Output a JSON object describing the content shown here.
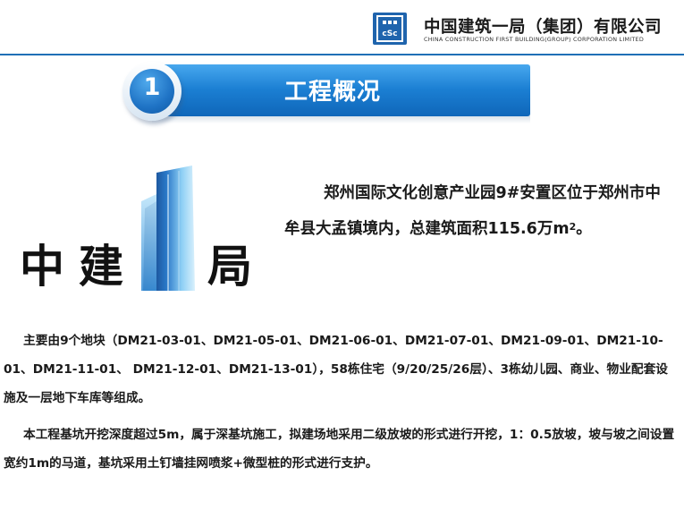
{
  "header": {
    "company_cn": "中国建筑一局（集团）有限公司",
    "company_en": "CHINA CONSTRUCTION FIRST BUILDING(GROUP) CORPORATION LIMITED",
    "logo_icon": "cscec-logo-icon",
    "accent_color": "#1f6fb6"
  },
  "section": {
    "number": "1",
    "title": "工程概况"
  },
  "brand": {
    "chars": [
      "中",
      "建",
      "局"
    ],
    "logo_icon": "tower-one-icon"
  },
  "intro": {
    "text": "郑州国际文化创意产业园9#安置区位于郑州市中牟县大孟镇境内，总建筑面积115.6万m",
    "superscript": "2",
    "suffix": "。"
  },
  "paragraphs": [
    "主要由9个地块（DM21-03-01、DM21-05-01、DM21-06-01、DM21-07-01、DM21-09-01、DM21-10-01、DM21-11-01、 DM21-12-01、DM21-13-01），58栋住宅（9/20/25/26层）、3栋幼儿园、商业、物业配套设施及一层地下车库等组成。",
    "本工程基坑开挖深度超过5m，属于深基坑施工，拟建场地采用二级放坡的形式进行开挖，1：0.5放坡，坡与坡之间设置宽约1m的马道，基坑采用土钉墙挂网喷浆+微型桩的形式进行支护。"
  ]
}
